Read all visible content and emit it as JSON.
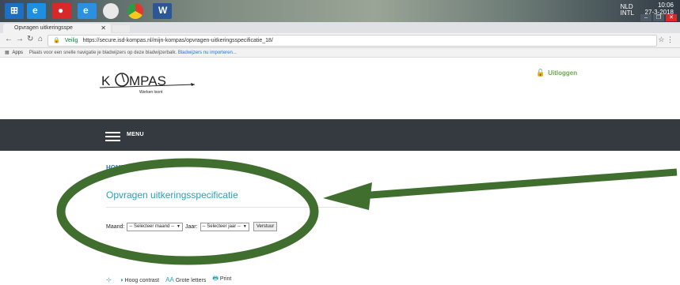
{
  "taskbar": {
    "icons": [
      "windows-start-icon",
      "internet-explorer-icon",
      "pinned-app-icon",
      "internet-explorer-icon",
      "circle-app-icon",
      "chrome-icon",
      "word-icon"
    ],
    "lang": "NLD",
    "lang2": "INTL",
    "time": "10:06",
    "date": "27-3-2018"
  },
  "browser": {
    "tab_title": "Opvragen uitkeringsspe",
    "secure_label": "Veilig",
    "url": "https://secure.isd-kompas.nl/mijn-kompas/opvragen-uitkeringsspecificatie_18/",
    "bookmarks_apps": "Apps",
    "bookmarks_text": "Plaats voor een snelle navigatie je bladwijzers op deze bladwijzerbalk.",
    "bookmarks_link": "Bladwijzers nu importeren..."
  },
  "site": {
    "logo_text_k": "K",
    "logo_text_rest": "MPAS",
    "logo_sub": "Werken loont",
    "logout": "Uitloggen",
    "menu": "MENU",
    "breadcrumb_home": "HOME",
    "breadcrumb_sep": "|",
    "breadcrumb_current": "Opv",
    "page_title": "Opvragen uitkeringsspecificatie",
    "form": {
      "month_label": "Maand:",
      "month_value": "-- Selecteer maand --",
      "year_label": "Jaar:",
      "year_value": "-- Selecteer jaar --",
      "submit": "Verstuur"
    },
    "footer": {
      "contrast": "Hoog contrast",
      "large_text": "Grote letters",
      "large_text_icon": "AA",
      "print": "Print"
    }
  },
  "colors": {
    "menubar": "#343a40",
    "accent": "#2aa0b7",
    "annotation": "#3f6e2f"
  }
}
